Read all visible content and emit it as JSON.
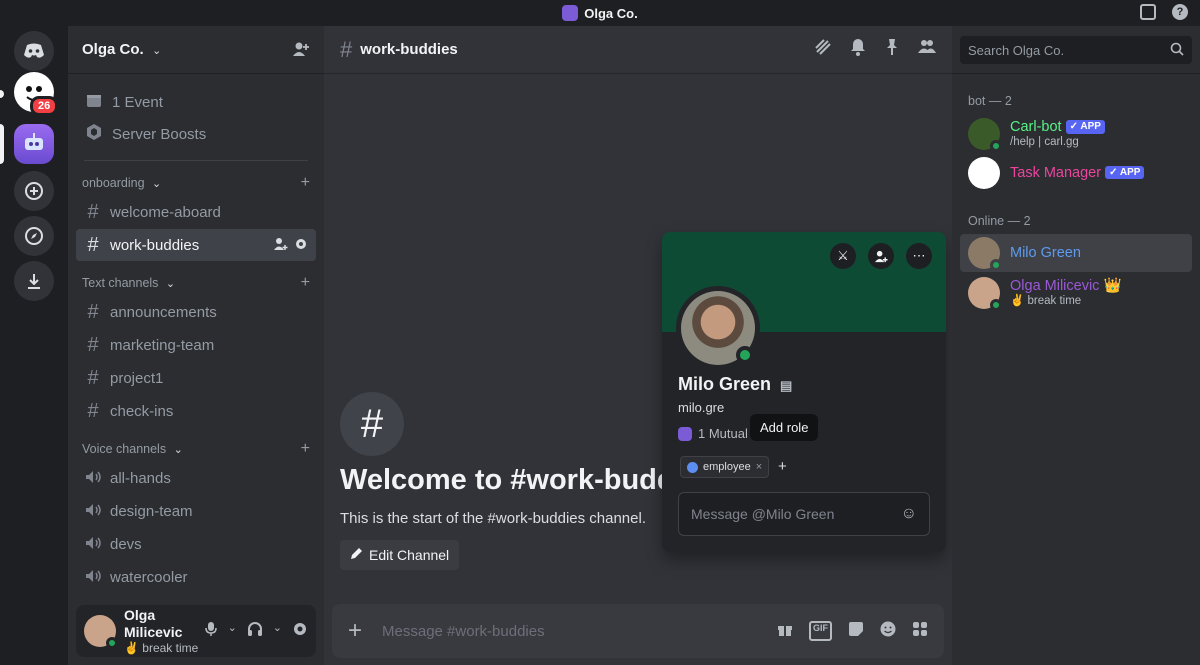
{
  "titlebar": {
    "server": "Olga Co."
  },
  "rail": {
    "badge": "26"
  },
  "sidebar": {
    "server_name": "Olga Co.",
    "top_items": [
      {
        "label": "1 Event"
      },
      {
        "label": "Server Boosts"
      }
    ],
    "categories": [
      {
        "name": "onboarding",
        "channels": [
          "welcome-aboard",
          "work-buddies"
        ]
      },
      {
        "name": "Text channels",
        "channels": [
          "announcements",
          "marketing-team",
          "project1",
          "check-ins"
        ]
      },
      {
        "name": "Voice channels",
        "channels": [
          "all-hands",
          "design-team",
          "devs",
          "watercooler"
        ]
      }
    ]
  },
  "user_panel": {
    "name": "Olga Milicevic",
    "status": "✌️ break time"
  },
  "chat": {
    "channel": "work-buddies",
    "welcome_title": "Welcome to #work-budd",
    "welcome_sub": "This is the start of the #work-buddies channel.",
    "edit_label": "Edit Channel",
    "composer_placeholder": "Message #work-buddies",
    "gif_label": "GIF"
  },
  "popout": {
    "name": "Milo Green",
    "handle": "milo.gre",
    "mutual": "1 Mutual S",
    "tooltip": "Add role",
    "role": "employee",
    "message_placeholder": "Message @Milo Green"
  },
  "members": {
    "search_placeholder": "Search Olga Co.",
    "bot_group": "bot — 2",
    "online_group": "Online — 2",
    "bots": [
      {
        "name": "Carl-bot",
        "badge": "APP",
        "sub": "/help | carl.gg",
        "color": "#57f287"
      },
      {
        "name": "Task Manager",
        "badge": "APP",
        "sub": "",
        "color": "#eb459e"
      }
    ],
    "online": [
      {
        "name": "Milo Green",
        "sub": "",
        "color": "#5c9bf0"
      },
      {
        "name": "Olga Milicevic",
        "sub": "✌️ break time",
        "color": "#9b59d6",
        "crown": "👑"
      }
    ]
  }
}
